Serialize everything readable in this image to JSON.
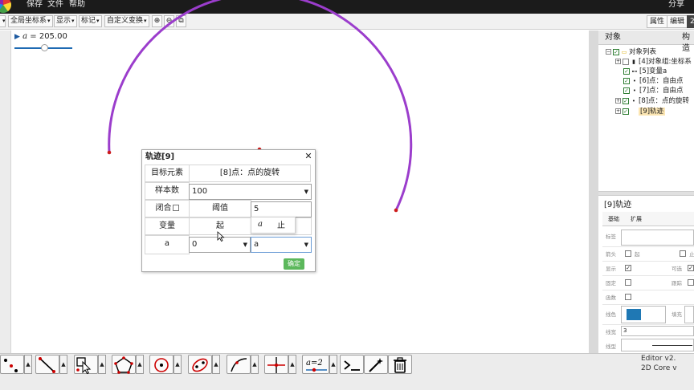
{
  "menu": {
    "items": [
      "保存",
      "文件",
      "帮助"
    ],
    "share_label": "分享"
  },
  "toolbar": {
    "coord_label": "全局坐标系",
    "display_label": "显示",
    "mark_label": "标记",
    "transform_label": "自定义变换",
    "tab_property": "属性",
    "tab_edit": "编辑",
    "tab_more": "2"
  },
  "slider": {
    "variable": "a",
    "equals": " = ",
    "value": "205.00",
    "fraction": 0.52
  },
  "dialog": {
    "title": "轨迹[9]",
    "target_label": "目标元素",
    "target_value": "[8]点：点的旋转",
    "samples_label": "样本数",
    "samples_value": "100",
    "closed_label": "闭合",
    "threshold_label": "阈值",
    "threshold_value": "5",
    "variable_label": "变量",
    "start_label": "起",
    "end_label": "止",
    "var_name": "a",
    "start_value": "0",
    "end_value": "a",
    "popup_value": "a",
    "confirm_label": "确定"
  },
  "objects_panel": {
    "title": "对象",
    "title_right": "构造",
    "tree": [
      {
        "text": "对象列表",
        "icon": "folder-icon"
      },
      {
        "text": "[4]对象组:坐标系",
        "icon": "bar-chart-icon"
      },
      {
        "text": "[5]变量a",
        "icon": "slider-icon"
      },
      {
        "text": "[6]点：自由点",
        "icon": "point-icon"
      },
      {
        "text": "[7]点：自由点",
        "icon": "point-icon"
      },
      {
        "text": "[8]点：点的旋转",
        "icon": "point-icon"
      },
      {
        "text": "[9]轨迹",
        "icon": "locus-icon"
      }
    ]
  },
  "props_panel": {
    "title": "[9]轨迹",
    "tab_basic": "基础",
    "tab_extend": "扩展",
    "label_tag": "标签",
    "label_arrow": "箭头",
    "label_start": "起",
    "label_end": "止",
    "label_show": "显示",
    "label_selectable": "可选",
    "label_fixed": "固定",
    "label_trace": "跟踪",
    "label_func": "函数",
    "label_color": "线色",
    "label_fill": "填充",
    "label_width": "线宽",
    "width_value": "3",
    "label_style": "线型",
    "stroke_color": "#1f78b4"
  },
  "footer": {
    "editor_version": "Editor v2.",
    "core_version": "2D Core v"
  },
  "colors": {
    "locus": "#9b3dcc",
    "point": "#cc1b1b",
    "confirm": "#5cb85c"
  }
}
